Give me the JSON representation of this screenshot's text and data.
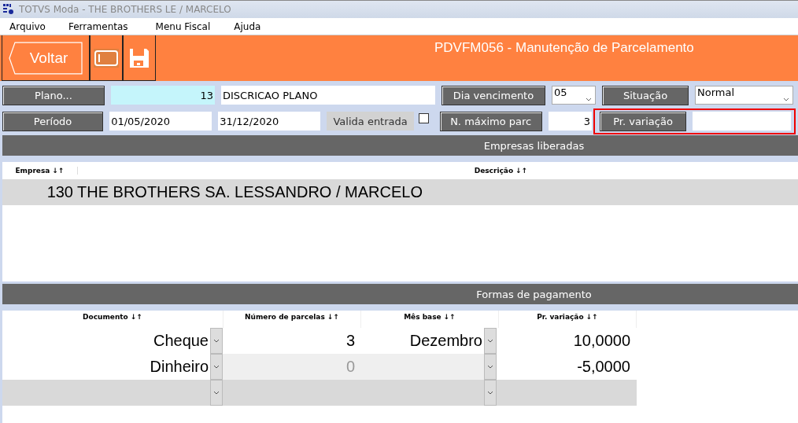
{
  "window": {
    "title": "TOTVS Moda - THE BROTHERS LE / MARCELO"
  },
  "menu": [
    {
      "label": "Arquivo"
    },
    {
      "label": "Ferramentas"
    },
    {
      "label": "Menu Fiscal"
    },
    {
      "label": "Ajuda"
    }
  ],
  "toolbar": {
    "back_label": "Voltar",
    "screen_title": "PDVFM056 - Manutenção de Parcelamento"
  },
  "form": {
    "plano_button": "Plano...",
    "plano_code": "13",
    "plano_description": "DISCRICAO PLANO",
    "dia_button": "Dia vencimento",
    "dia_value": "05",
    "situacao_button": "Situação",
    "situacao_value": "Normal",
    "periodo_button": "Período",
    "periodo_start": "01/05/2020",
    "periodo_end": "31/12/2020",
    "valida_label": "Valida entrada",
    "valida_checked": false,
    "max_button": "N. máximo parc",
    "max_value": "3",
    "variacao_button": "Pr. variação",
    "variacao_highlighted": true
  },
  "companies": {
    "title": "Empresas liberadas",
    "columns": [
      "Empresa ↓↑",
      "Descrição ↓↑"
    ],
    "rows": [
      {
        "code": "130",
        "name": "THE BROTHERS SA. LESSANDRO / MARCELO",
        "selected": true
      }
    ]
  },
  "payments": {
    "title": "Formas de pagamento",
    "columns": [
      "Documento ↓↑",
      "Número de parcelas ↓↑",
      "Mês base ↓↑",
      "Pr. variação ↓↑"
    ],
    "rows": [
      {
        "document": "Cheque",
        "installments": "3",
        "month": "Dezembro",
        "variation": "10,0000",
        "disabled": false,
        "selected": false
      },
      {
        "document": "Dinheiro",
        "installments": "0",
        "variation": "-5,0000",
        "disabled": true,
        "selected": false
      },
      {
        "disabled": false,
        "selected": true
      }
    ]
  }
}
